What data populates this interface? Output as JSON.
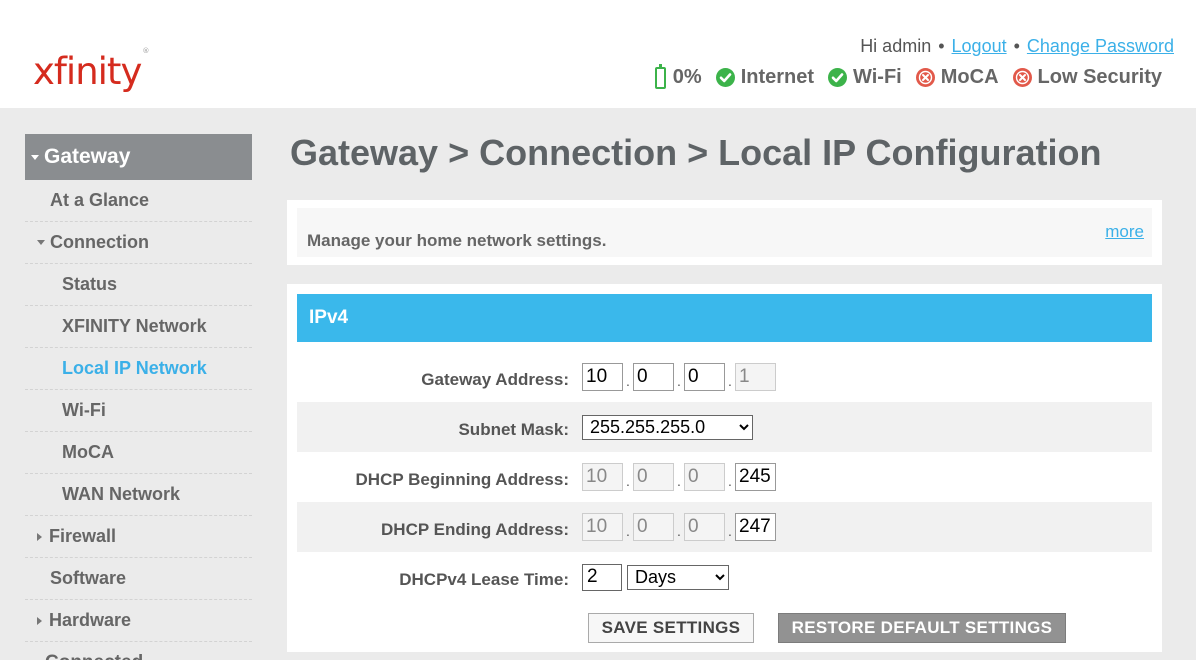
{
  "brand": {
    "logo_text": "xfinity",
    "color": "#d52b1e"
  },
  "header": {
    "greeting": "Hi admin",
    "separator": "•",
    "logout_label": "Logout",
    "change_password_label": "Change Password",
    "battery_label": "0%",
    "status": {
      "internet": {
        "label": "Internet",
        "state": "ok"
      },
      "wifi": {
        "label": "Wi-Fi",
        "state": "ok"
      },
      "moca": {
        "label": "MoCA",
        "state": "error"
      },
      "security": {
        "label": "Low Security",
        "state": "error"
      }
    }
  },
  "sidebar": {
    "top": "Gateway",
    "items": [
      {
        "label": "At a Glance"
      },
      {
        "label": "Connection"
      },
      {
        "label": "Status"
      },
      {
        "label": "XFINITY Network"
      },
      {
        "label": "Local IP Network"
      },
      {
        "label": "Wi-Fi"
      },
      {
        "label": "MoCA"
      },
      {
        "label": "WAN Network"
      },
      {
        "label": "Firewall"
      },
      {
        "label": "Software"
      },
      {
        "label": "Hardware"
      },
      {
        "label": "Connected"
      }
    ]
  },
  "page": {
    "title": "Gateway > Connection > Local IP Configuration",
    "description": "Manage your home network settings.",
    "more_label": "more"
  },
  "ipv4": {
    "header": "IPv4",
    "gateway": {
      "label": "Gateway Address:",
      "octets": [
        "10",
        "0",
        "0",
        "1"
      ]
    },
    "subnet": {
      "label": "Subnet Mask:",
      "value": "255.255.255.0"
    },
    "dhcp_begin": {
      "label": "DHCP Beginning Address:",
      "octets": [
        "10",
        "0",
        "0",
        "245"
      ]
    },
    "dhcp_end": {
      "label": "DHCP Ending Address:",
      "octets": [
        "10",
        "0",
        "0",
        "247"
      ]
    },
    "lease": {
      "label": "DHCPv4 Lease Time:",
      "value": "2",
      "unit": "Days"
    },
    "save_label": "SAVE SETTINGS",
    "restore_label": "RESTORE DEFAULT SETTINGS"
  },
  "colors": {
    "accent": "#3ab8eb",
    "ok": "#3cb34a",
    "error": "#e2594a",
    "nav_active": "#3bb0e8"
  }
}
